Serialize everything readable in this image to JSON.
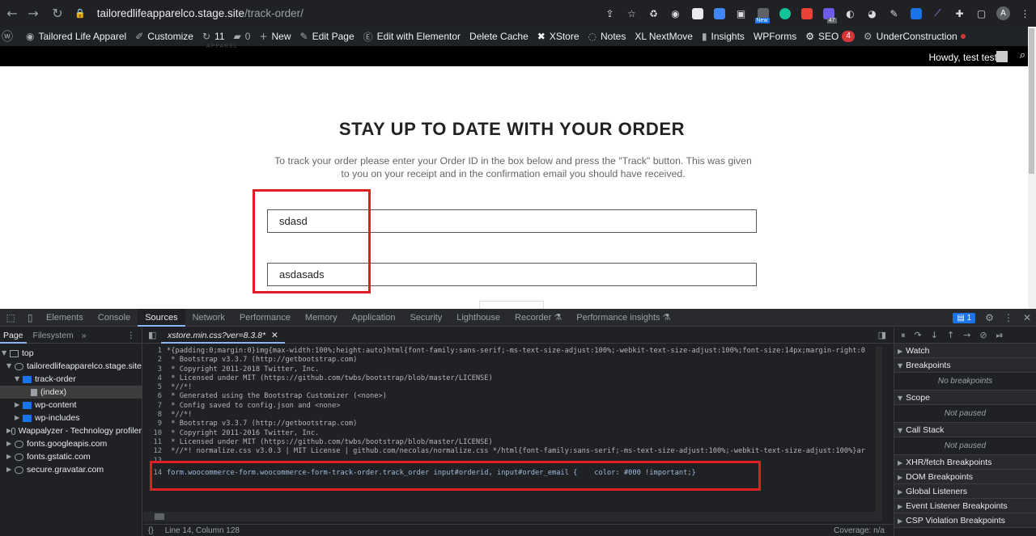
{
  "browser": {
    "url_host": "tailoredlifeapparelco.stage.site",
    "url_path": "/track-order/",
    "new_badge": "New",
    "ext_count": "47",
    "profile_initial": "A"
  },
  "wp_admin_bar": {
    "site_name": "Tailored Life Apparel",
    "items": [
      "Customize",
      "11",
      "0",
      "New",
      "Edit Page",
      "Edit with Elementor",
      "Delete Cache",
      "XStore",
      "Notes",
      "XL NextMove",
      "Insights",
      "WPForms",
      "SEO"
    ],
    "seo_count": "4",
    "under_construction": "UnderConstruction",
    "howdy": "Howdy, test test"
  },
  "page": {
    "logo_sub": "APPAREL",
    "title": "STAY UP TO DATE WITH YOUR ORDER",
    "description": "To track your order please enter your Order ID in the box below and press the \"Track\" button. This was given to you on your receipt and in the confirmation email you should have received.",
    "order_id_value": "sdasd",
    "email_value": "asdasads"
  },
  "devtools": {
    "tabs": [
      "Elements",
      "Console",
      "Sources",
      "Network",
      "Performance",
      "Memory",
      "Application",
      "Security",
      "Lighthouse",
      "Recorder",
      "Performance insights"
    ],
    "active_tab": "Sources",
    "issues_count": "1",
    "nav_tabs": [
      "Page",
      "Filesystem"
    ],
    "tree": [
      {
        "label": "top",
        "indent": 0
      },
      {
        "label": "tailoredlifeapparelco.stage.site",
        "indent": 1
      },
      {
        "label": "track-order",
        "indent": 2
      },
      {
        "label": "(index)",
        "indent": 3
      },
      {
        "label": "wp-content",
        "indent": 2
      },
      {
        "label": "wp-includes",
        "indent": 2
      },
      {
        "label": "Wappalyzer - Technology profiler",
        "indent": 1
      },
      {
        "label": "fonts.googleapis.com",
        "indent": 1
      },
      {
        "label": "fonts.gstatic.com",
        "indent": 1
      },
      {
        "label": "secure.gravatar.com",
        "indent": 1
      }
    ],
    "open_file": "xstore.min.css?ver=8.3.8*",
    "code_lines": [
      "*{padding:0;margin:0}img{max-width:100%;height:auto}html{font-family:sans-serif;-ms-text-size-adjust:100%;-webkit-text-size-adjust:100%;font-size:14px;margin-right:0",
      " * Bootstrap v3.3.7 (http://getbootstrap.com)",
      " * Copyright 2011-2018 Twitter, Inc.",
      " * Licensed under MIT (https://github.com/twbs/bootstrap/blob/master/LICENSE)",
      " *//*!",
      " * Generated using the Bootstrap Customizer (<none>)",
      " * Config saved to config.json and <none>",
      " *//*!",
      " * Bootstrap v3.3.7 (http://getbootstrap.com)",
      " * Copyright 2011-2016 Twitter, Inc.",
      " * Licensed under MIT (https://github.com/twbs/bootstrap/blob/master/LICENSE)",
      " *//*! normalize.css v3.0.3 | MIT License | github.com/necolas/normalize.css */html{font-family:sans-serif;-ms-text-size-adjust:100%;-webkit-text-size-adjust:100%}ar",
      "",
      "form.woocommerce-form.woocommerce-form-track-order.track_order input#orderid, input#order_email {    color: #000 !important;}"
    ],
    "status_position": "Line 14, Column 128",
    "status_coverage": "Coverage: n/a",
    "debugger_sections": [
      {
        "title": "Watch",
        "body": ""
      },
      {
        "title": "Breakpoints",
        "body": "No breakpoints"
      },
      {
        "title": "Scope",
        "body": "Not paused"
      },
      {
        "title": "Call Stack",
        "body": "Not paused"
      },
      {
        "title": "XHR/fetch Breakpoints",
        "body": ""
      },
      {
        "title": "DOM Breakpoints",
        "body": ""
      },
      {
        "title": "Global Listeners",
        "body": ""
      },
      {
        "title": "Event Listener Breakpoints",
        "body": ""
      },
      {
        "title": "CSP Violation Breakpoints",
        "body": ""
      }
    ]
  },
  "colors": {
    "highlight_red": "#e01e25",
    "wp_bar": "#1d2327",
    "devtools_bg": "#202124"
  }
}
